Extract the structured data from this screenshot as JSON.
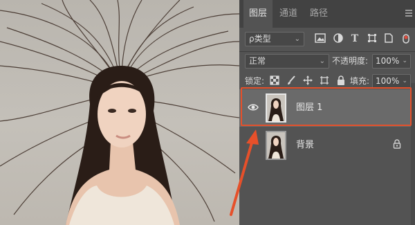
{
  "panel": {
    "tabs": [
      {
        "label": "图层",
        "active": true
      },
      {
        "label": "通道",
        "active": false
      },
      {
        "label": "路径",
        "active": false
      }
    ],
    "filter": {
      "label": "ρ类型"
    },
    "blend_mode": "正常",
    "opacity_label": "不透明度:",
    "opacity_value": "100%",
    "lock_label": "锁定:",
    "fill_label": "填充:",
    "fill_value": "100%",
    "layers": [
      {
        "name": "图层 1",
        "selected": true,
        "visible": true
      },
      {
        "name": "背景",
        "selected": false,
        "visible": false,
        "locked": true
      }
    ]
  },
  "colors": {
    "panel_bg": "#535353",
    "tab_bar": "#424242",
    "selected_layer": "#6a6a6a",
    "highlight": "#e6502a",
    "arrow": "#e6502a"
  },
  "icons": [
    "search-icon",
    "image-filter-icon",
    "adjustment-filter-icon",
    "type-filter-icon",
    "shape-filter-icon",
    "smart-object-filter-icon",
    "filter-toggle-icon",
    "lock-pixels-icon",
    "lock-paint-icon",
    "lock-position-icon",
    "lock-artboard-icon",
    "lock-all-icon",
    "eye-icon",
    "lock-icon",
    "panel-menu-icon"
  ]
}
